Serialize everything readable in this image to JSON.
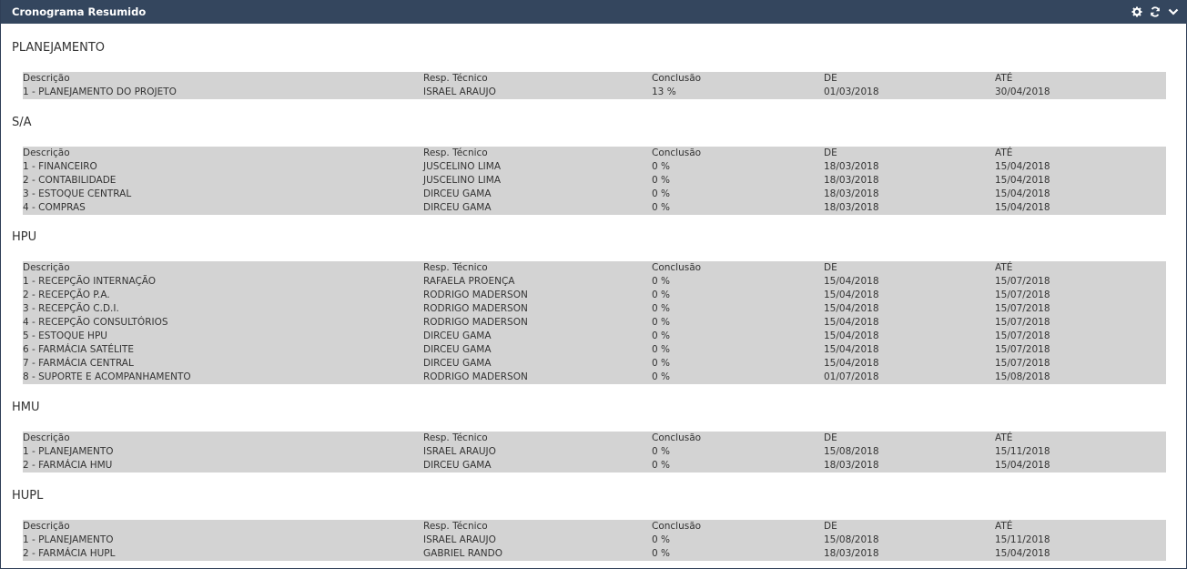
{
  "header": {
    "title": "Cronograma Resumido",
    "icons": [
      "gear-icon",
      "refresh-icon",
      "chevron-down-icon"
    ]
  },
  "columns": {
    "desc": "Descrição",
    "resp": "Resp. Técnico",
    "conc": "Conclusão",
    "de": "DE",
    "ate": "ATÉ"
  },
  "sections": [
    {
      "title": "PLANEJAMENTO",
      "rows": [
        {
          "desc": "1 - PLANEJAMENTO DO PROJETO",
          "resp": "ISRAEL ARAUJO",
          "conc": "13 %",
          "de": "01/03/2018",
          "ate": "30/04/2018"
        }
      ]
    },
    {
      "title": "S/A",
      "rows": [
        {
          "desc": "1 - FINANCEIRO",
          "resp": "JUSCELINO LIMA",
          "conc": "0 %",
          "de": "18/03/2018",
          "ate": "15/04/2018"
        },
        {
          "desc": "2 - CONTABILIDADE",
          "resp": "JUSCELINO LIMA",
          "conc": "0 %",
          "de": "18/03/2018",
          "ate": "15/04/2018"
        },
        {
          "desc": "3 - ESTOQUE CENTRAL",
          "resp": "DIRCEU GAMA",
          "conc": "0 %",
          "de": "18/03/2018",
          "ate": "15/04/2018"
        },
        {
          "desc": "4 - COMPRAS",
          "resp": "DIRCEU GAMA",
          "conc": "0 %",
          "de": "18/03/2018",
          "ate": "15/04/2018"
        }
      ]
    },
    {
      "title": "HPU",
      "rows": [
        {
          "desc": "1 - RECEPÇÃO INTERNAÇÃO",
          "resp": "RAFAELA PROENÇA",
          "conc": "0 %",
          "de": "15/04/2018",
          "ate": "15/07/2018"
        },
        {
          "desc": "2 - RECEPÇÃO P.A.",
          "resp": "RODRIGO MADERSON",
          "conc": "0 %",
          "de": "15/04/2018",
          "ate": "15/07/2018"
        },
        {
          "desc": "3 - RECEPÇÃO C.D.I.",
          "resp": "RODRIGO MADERSON",
          "conc": "0 %",
          "de": "15/04/2018",
          "ate": "15/07/2018"
        },
        {
          "desc": "4 - RECEPÇÃO CONSULTÓRIOS",
          "resp": "RODRIGO MADERSON",
          "conc": "0 %",
          "de": "15/04/2018",
          "ate": "15/07/2018"
        },
        {
          "desc": "5 - ESTOQUE HPU",
          "resp": "DIRCEU GAMA",
          "conc": "0 %",
          "de": "15/04/2018",
          "ate": "15/07/2018"
        },
        {
          "desc": "6 - FARMÁCIA SATÉLITE",
          "resp": "DIRCEU GAMA",
          "conc": "0 %",
          "de": "15/04/2018",
          "ate": "15/07/2018"
        },
        {
          "desc": "7 - FARMÁCIA CENTRAL",
          "resp": "DIRCEU GAMA",
          "conc": "0 %",
          "de": "15/04/2018",
          "ate": "15/07/2018"
        },
        {
          "desc": "8 - SUPORTE E ACOMPANHAMENTO",
          "resp": "RODRIGO MADERSON",
          "conc": "0 %",
          "de": "01/07/2018",
          "ate": "15/08/2018"
        }
      ]
    },
    {
      "title": "HMU",
      "rows": [
        {
          "desc": "1 - PLANEJAMENTO",
          "resp": "ISRAEL ARAUJO",
          "conc": "0 %",
          "de": "15/08/2018",
          "ate": "15/11/2018"
        },
        {
          "desc": "2 - FARMÁCIA HMU",
          "resp": "DIRCEU GAMA",
          "conc": "0 %",
          "de": "18/03/2018",
          "ate": "15/04/2018"
        }
      ]
    },
    {
      "title": "HUPL",
      "rows": [
        {
          "desc": "1 - PLANEJAMENTO",
          "resp": "ISRAEL ARAUJO",
          "conc": "0 %",
          "de": "15/08/2018",
          "ate": "15/11/2018"
        },
        {
          "desc": "2 - FARMÁCIA HUPL",
          "resp": "GABRIEL RANDO",
          "conc": "0 %",
          "de": "18/03/2018",
          "ate": "15/04/2018"
        }
      ]
    }
  ]
}
